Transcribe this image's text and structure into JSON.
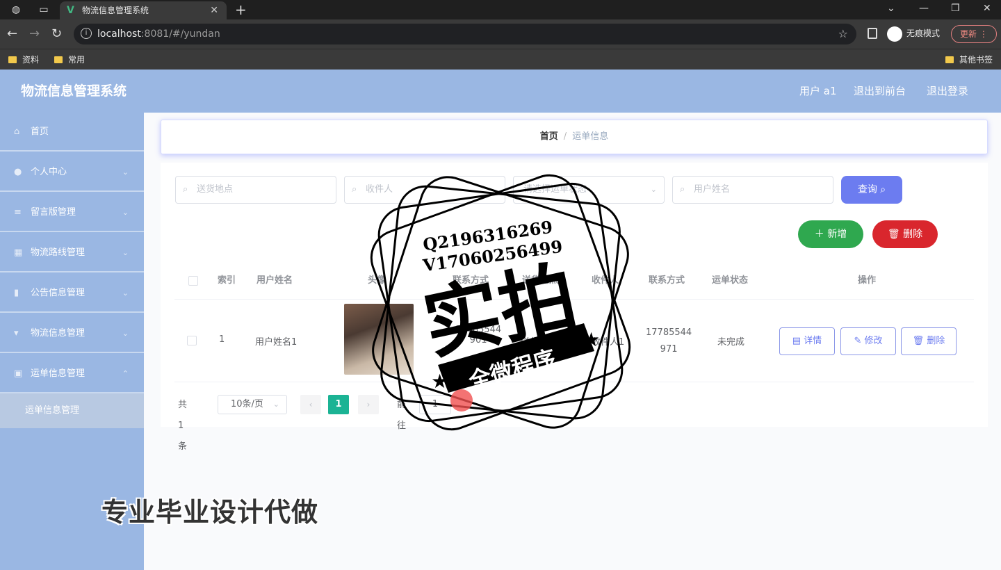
{
  "browser": {
    "tab_title": "物流信息管理系统",
    "url_host": "localhost",
    "url_rest": ":8081/#/yundan",
    "incognito_label": "无痕模式",
    "update_label": "更新",
    "bookmarks": [
      "资料",
      "常用"
    ],
    "other_bookmarks": "其他书签"
  },
  "header": {
    "title": "物流信息管理系统",
    "user": "用户 a1",
    "to_front": "退出到前台",
    "logout": "退出登录"
  },
  "sidebar": {
    "items": [
      {
        "label": "首页",
        "icon": "home-icon"
      },
      {
        "label": "个人中心",
        "icon": "user-icon"
      },
      {
        "label": "留言版管理",
        "icon": "list-icon"
      },
      {
        "label": "物流路线管理",
        "icon": "route-icon"
      },
      {
        "label": "公告信息管理",
        "icon": "notice-icon"
      },
      {
        "label": "物流信息管理",
        "icon": "trophy-icon"
      },
      {
        "label": "运单信息管理",
        "icon": "box-icon"
      }
    ],
    "sub_item": "运单信息管理"
  },
  "breadcrumb": {
    "home": "首页",
    "separator": "/",
    "current": "运单信息"
  },
  "search": {
    "placeholders": [
      "送货地点",
      "收件人",
      "请选择运单状态",
      "用户姓名"
    ],
    "query_button": "查询"
  },
  "actions": {
    "add": "新增",
    "delete": "删除"
  },
  "table": {
    "headers": [
      "索引",
      "用户姓名",
      "头像",
      "联系方式",
      "送货地点",
      "收件人",
      "联系方式",
      "运单状态",
      "操作"
    ],
    "rows": [
      {
        "index": "1",
        "username": "用户姓名1",
        "phone1_a": "17785544",
        "phone1_b": "901",
        "address": "送货地点1",
        "recipient": "收件人1",
        "phone2_a": "17785544",
        "phone2_b": "971",
        "status": "未完成",
        "btn_detail": "详情",
        "btn_edit": "修改",
        "btn_delete": "删除"
      }
    ]
  },
  "pagination": {
    "total": "共 1 条",
    "page_size": "10条/页",
    "current_page": "1",
    "goto": "前往",
    "goto_value": "1"
  },
  "overlay": {
    "stamp_line1": "Q2196316269",
    "stamp_line2": "V17060256499",
    "stamp_big": "实拍",
    "stamp_banner": "全微程序",
    "bottom_watermark": "专业毕业设计代做"
  },
  "colors": {
    "header_bg": "#9ab7e3",
    "primary": "#6c7cf0",
    "success": "#2fa84f",
    "danger": "#d9262d",
    "pager_active": "#1bb394"
  }
}
